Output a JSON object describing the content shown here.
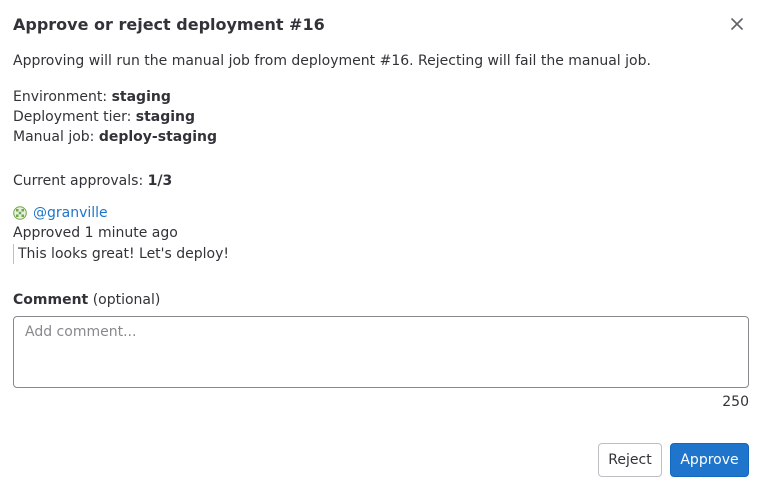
{
  "modal": {
    "title": "Approve or reject deployment #16",
    "close_icon": "close-icon"
  },
  "description": "Approving will run the manual job from deployment #16. Rejecting will fail the manual job.",
  "details": {
    "environment_label": "Environment:",
    "environment_value": "staging",
    "tier_label": "Deployment tier:",
    "tier_value": "staging",
    "job_label": "Manual job:",
    "job_value": "deploy-staging"
  },
  "approvals": {
    "label": "Current approvals:",
    "value": "1/3"
  },
  "approval_entry": {
    "avatar_icon": "identicon-avatar",
    "username": "@granville",
    "status": "Approved 1 minute ago",
    "comment": "This looks great! Let's deploy!"
  },
  "comment": {
    "label": "Comment",
    "optional": "(optional)",
    "placeholder": "Add comment...",
    "value": "",
    "remaining": "250"
  },
  "actions": {
    "reject_label": "Reject",
    "approve_label": "Approve"
  },
  "colors": {
    "link": "#1f75cb",
    "primary_button": "#1f75cb",
    "text": "#333238",
    "avatar_green": "#6fa84a"
  }
}
